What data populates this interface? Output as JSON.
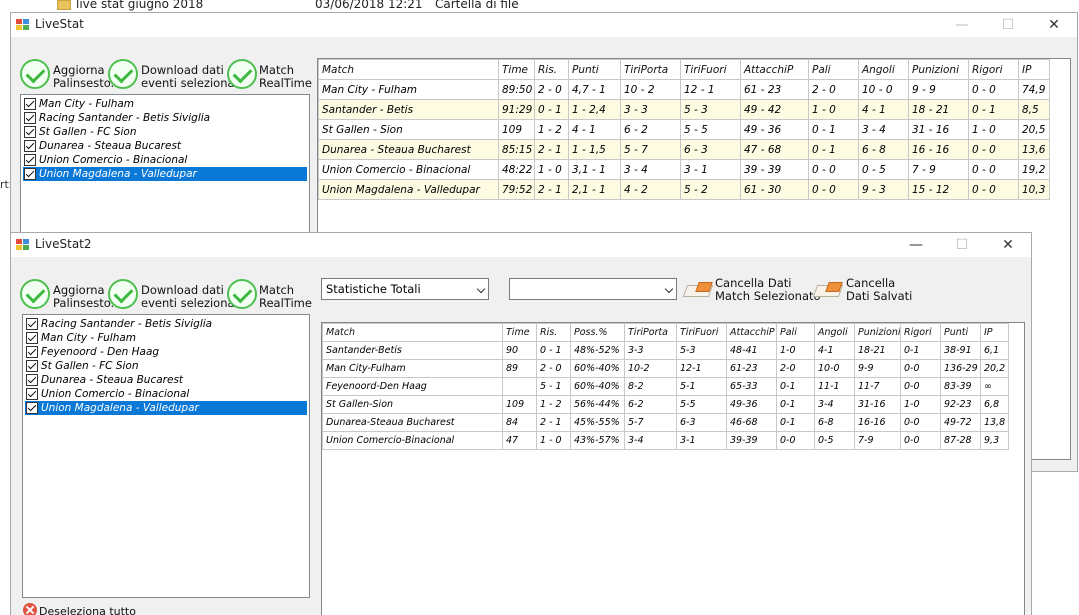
{
  "explorer": {
    "name": "live stat giugno 2018",
    "date": "03/06/2018 12:21",
    "type": "Cartella di file",
    "stub": "rti"
  },
  "win1": {
    "title": "LiveStat",
    "controls": {
      "minimize": "—",
      "maximize": "☐",
      "close": "✕"
    },
    "buttons": [
      {
        "icon": "check-circle-icon",
        "label": "Aggiorna\nPalinsesto."
      },
      {
        "icon": "check-circle-icon",
        "label": "Download dati\neventi selezionati."
      },
      {
        "icon": "check-circle-icon",
        "label": "Match\nRealTime"
      }
    ],
    "matches": [
      "Man City - Fulham",
      "Racing Santander - Betis Siviglia",
      "St Gallen - FC Sion",
      "Dunarea - Steaua Bucarest",
      "Union Comercio - Binacional",
      "Union Magdalena - Valledupar"
    ],
    "selected_index": 5,
    "table": {
      "headers": [
        "Match",
        "Time",
        "Ris.",
        "Punti",
        "TiriPorta",
        "TiriFuori",
        "AttacchiP",
        "Pali",
        "Angoli",
        "Punizioni",
        "Rigori",
        "IP"
      ],
      "rows": [
        [
          "Man City - Fulham",
          "89:50",
          "2 - 0",
          "4,7 - 1",
          "10 - 2",
          "12 - 1",
          "61 - 23",
          "2 - 0",
          "10 - 0",
          "9 - 9",
          "0 - 0",
          "74,9"
        ],
        [
          "Santander - Betis",
          "91:29",
          "0 - 1",
          "1 - 2,4",
          "3 - 3",
          "5 - 3",
          "49 - 42",
          "1 - 0",
          "4 - 1",
          "18 - 21",
          "0 - 1",
          "8,5"
        ],
        [
          "St Gallen - Sion",
          "109",
          "1 - 2",
          "4 - 1",
          "6 - 2",
          "5 - 5",
          "49 - 36",
          "0 - 1",
          "3 - 4",
          "31 - 16",
          "1 - 0",
          "20,5"
        ],
        [
          "Dunarea - Steaua Bucharest",
          "85:15",
          "2 - 1",
          "1 - 1,5",
          "5 - 7",
          "6 - 3",
          "47 - 68",
          "0 - 1",
          "6 - 8",
          "16 - 16",
          "0 - 0",
          "13,6"
        ],
        [
          "Union Comercio - Binacional",
          "48:22",
          "1 - 0",
          "3,1 - 1",
          "3 - 4",
          "3 - 1",
          "39 - 39",
          "0 - 0",
          "0 - 5",
          "7 - 9",
          "0 - 0",
          "19,2"
        ],
        [
          "Union Magdalena - Valledupar",
          "79:52",
          "2 - 1",
          "2,1 - 1",
          "4 - 2",
          "5 - 2",
          "61 - 30",
          "0 - 0",
          "9 - 3",
          "15 - 12",
          "0 - 0",
          "10,3"
        ]
      ]
    }
  },
  "win2": {
    "title": "LiveStat2",
    "controls": {
      "minimize": "—",
      "maximize": "☐",
      "close": "✕"
    },
    "buttons": [
      {
        "icon": "check-circle-icon",
        "label": "Aggiorna\nPalinsesto."
      },
      {
        "icon": "check-circle-icon",
        "label": "Download dati\neventi selezionati."
      },
      {
        "icon": "check-circle-icon",
        "label": "Match\nRealTime"
      }
    ],
    "matches": [
      "Racing Santander - Betis Siviglia",
      "Man City - Fulham",
      "Feyenoord - Den Haag",
      "St Gallen - FC Sion",
      "Dunarea - Steaua Bucarest",
      "Union Comercio - Binacional",
      "Union Magdalena - Valledupar"
    ],
    "selected_index": 6,
    "combo1": "Statistiche Totali",
    "combo2": "",
    "cancel_selected_label": "Cancella Dati\nMatch Selezionato",
    "cancel_saved_label": "Cancella\nDati Salvati",
    "deselect_label": "Deseleziona tutto",
    "table": {
      "headers": [
        "Match",
        "Time",
        "Ris.",
        "Poss.%",
        "TiriPorta",
        "TiriFuori",
        "AttacchiP",
        "Pali",
        "Angoli",
        "Punizioni",
        "Rigori",
        "Punti",
        "IP"
      ],
      "rows": [
        [
          "Santander-Betis",
          "90",
          "0 - 1",
          "48%-52%",
          "3-3",
          "5-3",
          "48-41",
          "1-0",
          "4-1",
          "18-21",
          "0-1",
          "38-91",
          "6,1"
        ],
        [
          "Man City-Fulham",
          "89",
          "2 - 0",
          "60%-40%",
          "10-2",
          "12-1",
          "61-23",
          "2-0",
          "10-0",
          "9-9",
          "0-0",
          "136-29",
          "20,2"
        ],
        [
          "Feyenoord-Den Haag",
          "",
          "5 - 1",
          "60%-40%",
          "8-2",
          "5-1",
          "65-33",
          "0-1",
          "11-1",
          "11-7",
          "0-0",
          "83-39",
          "∞"
        ],
        [
          "St Gallen-Sion",
          "109",
          "1 - 2",
          "56%-44%",
          "6-2",
          "5-5",
          "49-36",
          "0-1",
          "3-4",
          "31-16",
          "1-0",
          "92-23",
          "6,8"
        ],
        [
          "Dunarea-Steaua Bucharest",
          "84",
          "2 - 1",
          "45%-55%",
          "5-7",
          "6-3",
          "46-68",
          "0-1",
          "6-8",
          "16-16",
          "0-0",
          "49-72",
          "13,8"
        ],
        [
          "Union Comercio-Binacional",
          "47",
          "1 - 0",
          "43%-57%",
          "3-4",
          "3-1",
          "39-39",
          "0-0",
          "0-5",
          "7-9",
          "0-0",
          "87-28",
          "9,3"
        ]
      ]
    }
  }
}
